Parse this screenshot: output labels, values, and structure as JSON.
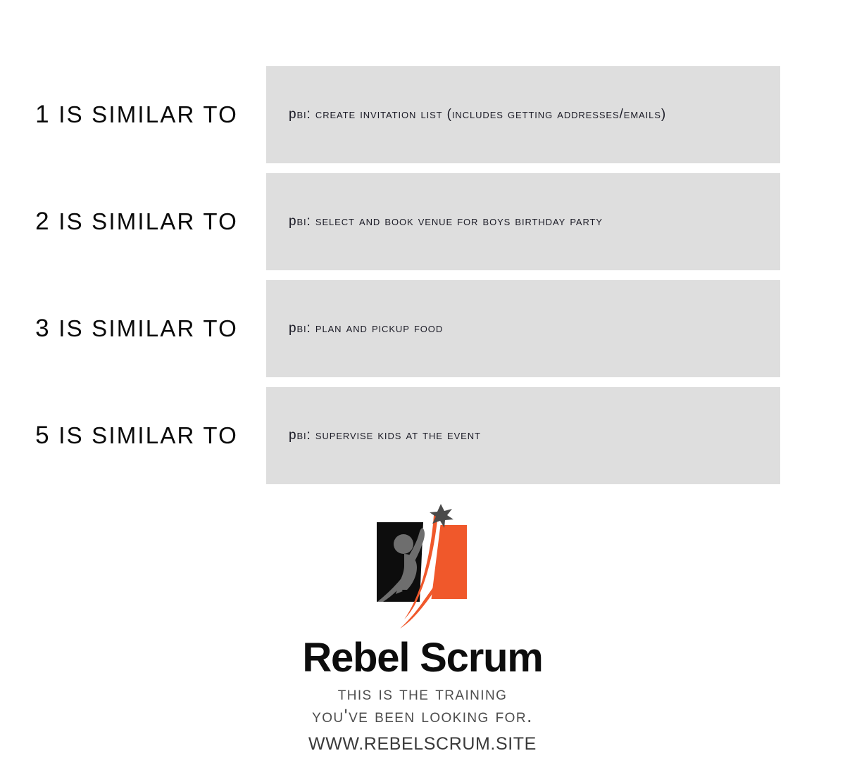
{
  "slide": {
    "background_color": "#ffffff",
    "card_color": "#dedede",
    "text_color": "#1b1b26",
    "accent_color": "#f0582b"
  },
  "rows": [
    {
      "estimate": "1",
      "relation_text": "IS SIMILAR TO",
      "card_text": "PBI: Create invitation list (includes getting addresses/emails)"
    },
    {
      "estimate": "2",
      "relation_text": "IS SIMILAR TO",
      "card_text": "PBI: Select and book Venue for boys birthday party"
    },
    {
      "estimate": "3",
      "relation_text": "IS SIMILAR TO",
      "card_text": "PBI: Plan and Pickup food"
    },
    {
      "estimate": "5",
      "relation_text": "IS SIMILAR TO",
      "card_text": "PBI: Supervise kids at the event"
    }
  ],
  "brand": {
    "logo_icon": "rebel-scrum-logo-icon",
    "wordmark": "Rebel Scrum",
    "tagline_line1": "This is the training",
    "tagline_line2": "you've been looking for.",
    "url": "WWW.REBELSCRUM.SITE",
    "colors": {
      "orange": "#f0582b",
      "black": "#0d0d0d",
      "figure_grey": "#6e6e6e",
      "star_grey": "#4a4a4a"
    }
  }
}
